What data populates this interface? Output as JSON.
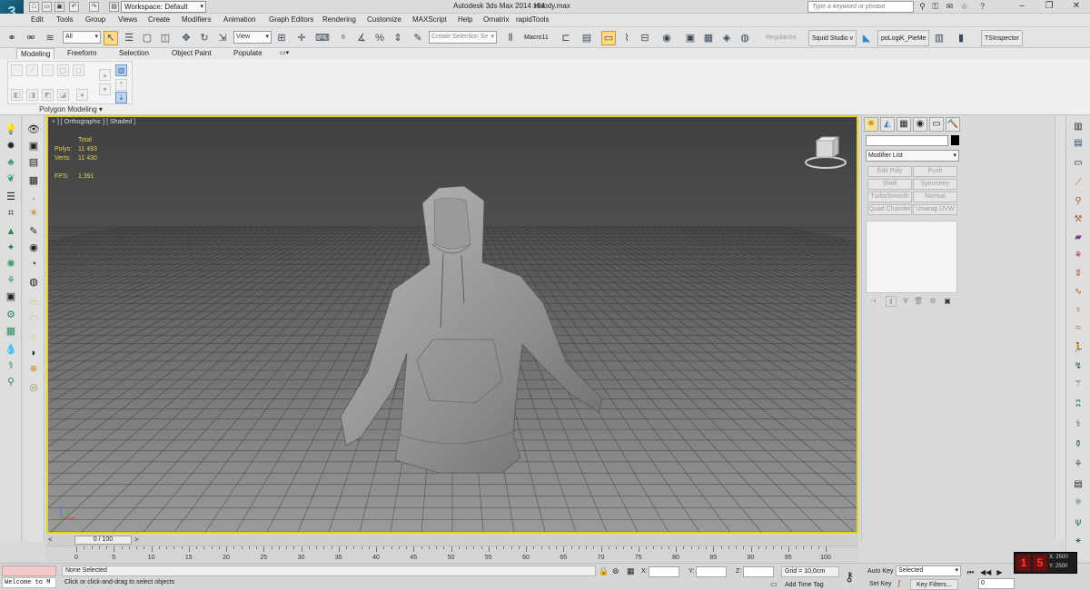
{
  "titlebar": {
    "app_logo": "3",
    "workspace": "Workspace: Default",
    "app_title": "Autodesk 3ds Max  2014 x64",
    "file_title": "Hoody.max",
    "search_placeholder": "Type a keyword or phrase"
  },
  "menu": [
    "Edit",
    "Tools",
    "Group",
    "Views",
    "Create",
    "Modifiers",
    "Animation",
    "Graph Editors",
    "Rendering",
    "Customize",
    "MAXScript",
    "Help",
    "Ornatrix",
    "rapidTools"
  ],
  "toolbar": {
    "filter": "All",
    "ref_coord": "View",
    "selection_set_placeholder": "Create Selection Se",
    "macro": "Macro11",
    "regularize": "Regularize",
    "squid": "Squid Studio v",
    "topologik": "poLogiK_PieMe",
    "tsinspector": "TSInspector"
  },
  "ribbon": {
    "tabs": [
      "Modeling",
      "Freeform",
      "Selection",
      "Object Paint",
      "Populate"
    ],
    "panel_title": "Polygon Modeling"
  },
  "viewport": {
    "label": "+ ] [ Orthographic ] [ Shaded ]",
    "stats": {
      "header": "Total",
      "polys_label": "Polys:",
      "polys_value": "11 493",
      "verts_label": "Verts:",
      "verts_value": "11 430",
      "fps_label": "FPS:",
      "fps_value": "1,391"
    }
  },
  "command_panel": {
    "modifier_list": "Modifier List",
    "modifier_buttons": [
      "Edit Poly",
      "Push",
      "Shell",
      "Symmetry",
      "TurboSmooth",
      "Normal",
      "Quad Chamfer",
      "Unwrap UVW"
    ]
  },
  "timeline": {
    "slider": "0 / 100",
    "ticks": [
      0,
      5,
      10,
      15,
      20,
      25,
      30,
      35,
      40,
      45,
      50,
      55,
      60,
      65,
      70,
      75,
      80,
      85,
      90,
      95,
      100
    ]
  },
  "status": {
    "listener": "Welcome to M",
    "selection": "None Selected",
    "prompt": "Click or click-and-drag to select objects",
    "x_label": "X:",
    "y_label": "Y:",
    "z_label": "Z:",
    "grid": "Grid = 10,0cm",
    "add_time_tag": "Add Time Tag",
    "auto_key": "Auto Key",
    "set_key": "Set Key",
    "selected_drop": "Selected",
    "key_filters": "Key Filters...",
    "frame": "0"
  },
  "overlay": {
    "n1": "1",
    "n2": "5",
    "x": "X: 2500",
    "y": "Y: 2500"
  }
}
